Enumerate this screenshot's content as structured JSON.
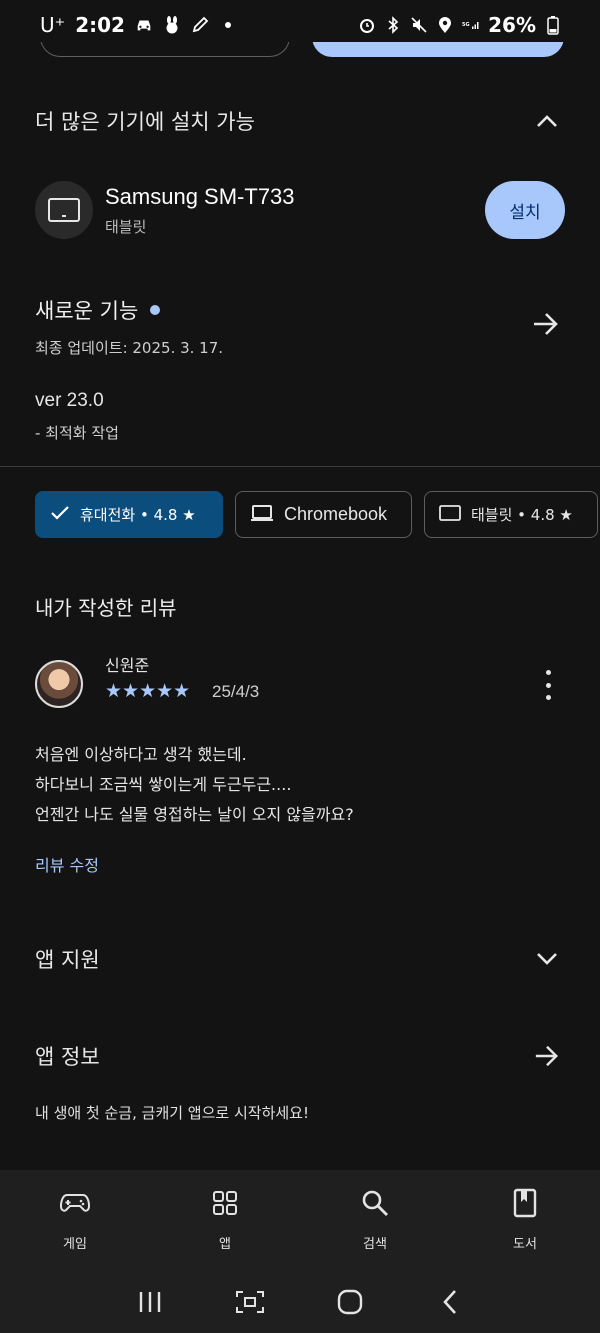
{
  "status_bar": {
    "carrier": "U⁺",
    "time": "2:02",
    "battery": "26%"
  },
  "more_devices": {
    "title": "더 많은 기기에 설치 가능",
    "device_name": "Samsung SM-T733",
    "device_type": "태블릿",
    "install_label": "설치"
  },
  "whats_new": {
    "title": "새로운 기능",
    "updated": "최종 업데이트: 2025. 3. 17.",
    "version": "ver 23.0",
    "note": "- 최적화 작업"
  },
  "chips": [
    {
      "label": "휴대전화 • 4.8 ★",
      "selected": true,
      "icon": "check-icon"
    },
    {
      "label": "Chromebook",
      "selected": false,
      "icon": "laptop-icon"
    },
    {
      "label": "태블릿 • 4.8 ★",
      "selected": false,
      "icon": "tablet-icon"
    }
  ],
  "my_review": {
    "title": "내가 작성한 리뷰",
    "reviewer": "신원준",
    "stars": "★★★★★",
    "rating": 5,
    "date": "25/4/3",
    "body_lines": [
      "처음엔 이상하다고 생각 했는데.",
      "하다보니 조금씩 쌓이는게 두근두근....",
      "언젠간 나도 실물 영접하는 날이 오지 않을까요?"
    ],
    "edit_label": "리뷰 수정"
  },
  "app_support": {
    "title": "앱 지원"
  },
  "app_info": {
    "title": "앱 정보",
    "description": "내 생애 첫 순금, 금캐기 앱으로 시작하세요!"
  },
  "bottom_nav": [
    {
      "label": "게임",
      "icon": "gamepad-icon"
    },
    {
      "label": "앱",
      "icon": "apps-grid-icon"
    },
    {
      "label": "검색",
      "icon": "search-icon"
    },
    {
      "label": "도서",
      "icon": "book-icon"
    }
  ],
  "colors": {
    "background": "#131313",
    "accent": "#a8c7fa",
    "selected_chip": "#0b4e7e"
  }
}
